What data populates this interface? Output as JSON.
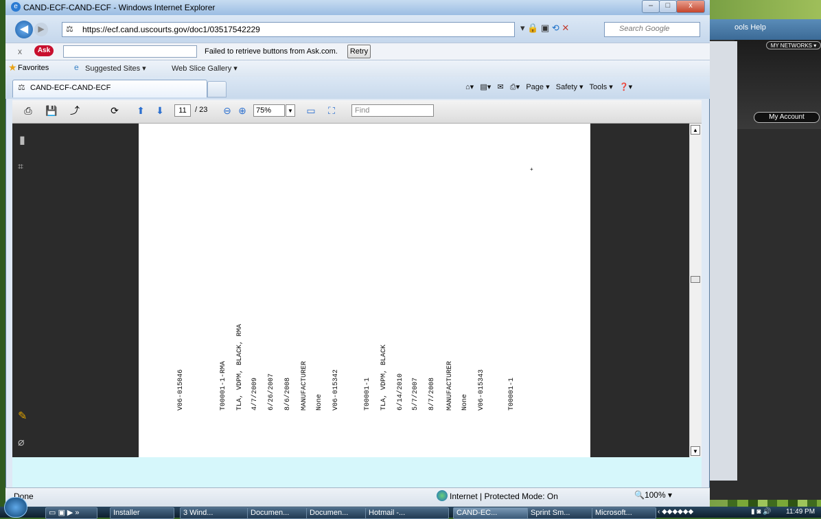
{
  "window": {
    "title": "CAND-ECF-CAND-ECF - Windows Internet Explorer",
    "minimize": "–",
    "maximize": "□",
    "close": "x"
  },
  "address": {
    "url": "https://ecf.cand.uscourts.gov/doc1/03517542229",
    "search_placeholder": "Search Google"
  },
  "ask_bar": {
    "logo": "Ask",
    "close": "x",
    "message": "Failed to retrieve buttons from Ask.com.",
    "retry": "Retry"
  },
  "favorites_bar": {
    "favorites": "Favorites",
    "suggested_sites": "Suggested Sites ▾",
    "web_slice": "Web Slice Gallery ▾"
  },
  "tabs": [
    {
      "label": "CAND-ECF-CAND-ECF"
    }
  ],
  "command_bar": {
    "page": "Page ▾",
    "safety": "Safety ▾",
    "tools": "Tools ▾",
    "help": "❓▾"
  },
  "pdf_toolbar": {
    "page_current": "11",
    "page_total": "/ 23",
    "zoom": "75%",
    "find_placeholder": "Find"
  },
  "pdf_content": {
    "columns": [
      "V06-015046",
      "T00001-1-RMA",
      "TLA, VDPM, BLACK, RMA",
      "4/7/2009",
      "6/26/2007",
      "8/6/2008",
      "MANUFACTURER",
      "None",
      "V06-015342",
      "T00001-1",
      "TLA, VDPM, BLACK",
      "6/14/2010",
      "5/7/2007",
      "8/7/2008",
      "MANUFACTURER",
      "None",
      "V06-015343",
      "T00001-1"
    ]
  },
  "status_bar": {
    "done": "Done",
    "zone": "Internet | Protected Mode: On",
    "zoom": "🔍100% ▾"
  },
  "background_window": {
    "menu": "ools  Help",
    "my_networks": "MY NETWORKS ▾",
    "my_account": "My Account"
  },
  "taskbar": {
    "buttons": [
      {
        "label": "Installer"
      },
      {
        "label": "3 Wind..."
      },
      {
        "label": "Documen..."
      },
      {
        "label": "Documen..."
      },
      {
        "label": "Hotmail -..."
      },
      {
        "label": "CAND-EC..."
      },
      {
        "label": "Sprint Sm..."
      },
      {
        "label": "Microsoft..."
      }
    ],
    "clock": "11:49 PM"
  }
}
